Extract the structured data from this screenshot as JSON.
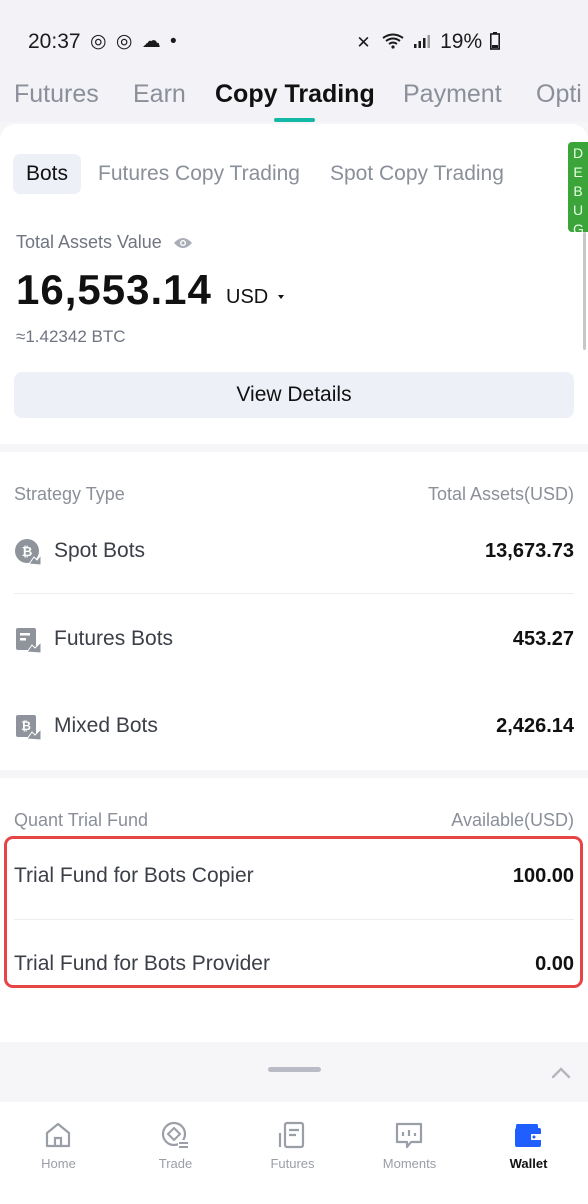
{
  "status_bar": {
    "time": "20:37",
    "icons_left": "◎ ◎ ☁ •",
    "battery": "19%"
  },
  "top_tabs": [
    {
      "label": "Futures"
    },
    {
      "label": "Earn"
    },
    {
      "label": "Copy Trading",
      "active": true
    },
    {
      "label": "Payment"
    },
    {
      "label": "Opti"
    }
  ],
  "sub_tabs": [
    {
      "label": "Bots",
      "active": true
    },
    {
      "label": "Futures Copy Trading"
    },
    {
      "label": "Spot Copy Trading"
    }
  ],
  "debug_label": "D E B U G",
  "assets": {
    "label": "Total Assets Value",
    "value": "16,553.14",
    "currency": "USD",
    "btc": "≈1.42342 BTC",
    "view_details": "View Details"
  },
  "strategy": {
    "header_left": "Strategy Type",
    "header_right": "Total Assets(USD)",
    "rows": [
      {
        "icon": "spot-bots-icon",
        "label": "Spot Bots",
        "value": "13,673.73"
      },
      {
        "icon": "futures-bots-icon",
        "label": "Futures Bots",
        "value": "453.27"
      },
      {
        "icon": "mixed-bots-icon",
        "label": "Mixed Bots",
        "value": "2,426.14"
      }
    ]
  },
  "trial_fund": {
    "header_left": "Quant Trial Fund",
    "header_right": "Available(USD)",
    "rows": [
      {
        "label": "Trial Fund for Bots Copier",
        "value": "100.00"
      },
      {
        "label": "Trial Fund for Bots Provider",
        "value": "0.00"
      }
    ],
    "highlight_color": "#e54545"
  },
  "bottom_nav": [
    {
      "label": "Home",
      "icon": "home-icon"
    },
    {
      "label": "Trade",
      "icon": "trade-icon"
    },
    {
      "label": "Futures",
      "icon": "futures-icon"
    },
    {
      "label": "Moments",
      "icon": "moments-icon"
    },
    {
      "label": "Wallet",
      "icon": "wallet-icon",
      "active": true
    }
  ],
  "colors": {
    "accent": "#15b8a4",
    "wallet_blue": "#1f5fff",
    "debug_green": "#3ca53a"
  }
}
